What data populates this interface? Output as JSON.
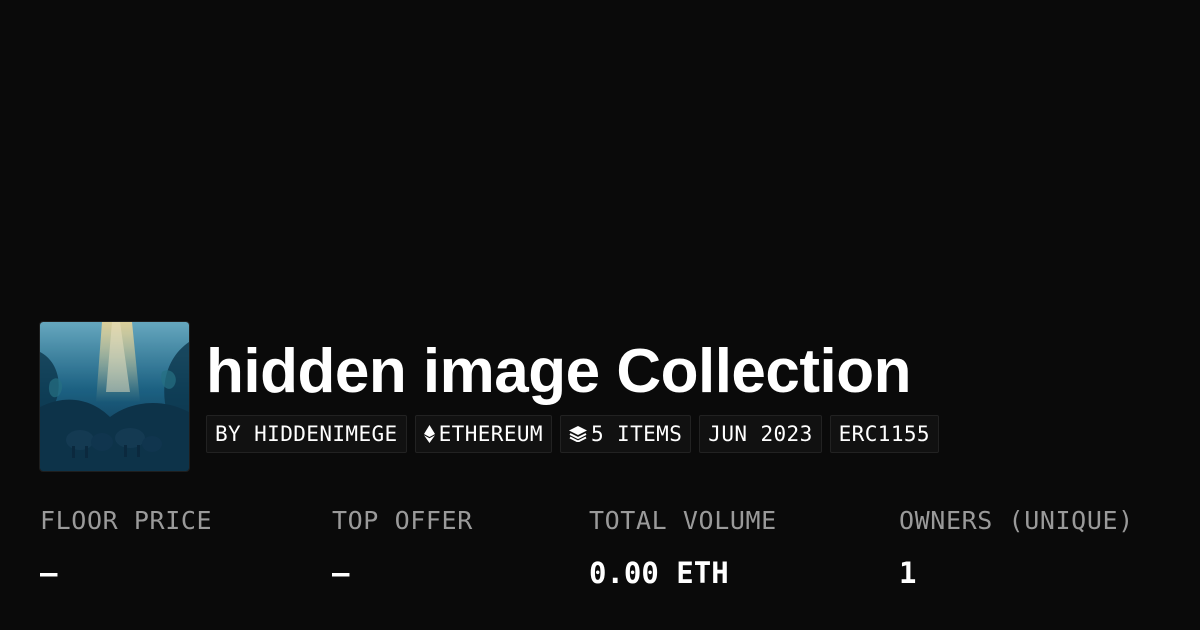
{
  "collection": {
    "thumbnail_icon": "collection-artwork-icon",
    "title": "hidden image Collection"
  },
  "badges": {
    "creator": "BY HIDDENIMEGE",
    "chain_icon": "ethereum-icon",
    "chain": "ETHEREUM",
    "items_icon": "layers-icon",
    "items": "5 ITEMS",
    "date": "JUN 2023",
    "standard": "ERC1155"
  },
  "stats": {
    "floor_price": {
      "label": "FLOOR PRICE",
      "value": "–"
    },
    "top_offer": {
      "label": "TOP OFFER",
      "value": "–"
    },
    "total_volume": {
      "label": "TOTAL VOLUME",
      "value": "0.00 ETH"
    },
    "owners": {
      "label": "OWNERS (UNIQUE)",
      "value": "1"
    }
  },
  "colors": {
    "background": "#0a0a0a",
    "text": "#ffffff",
    "muted": "#9a9a9a",
    "badge_border": "#222222"
  }
}
